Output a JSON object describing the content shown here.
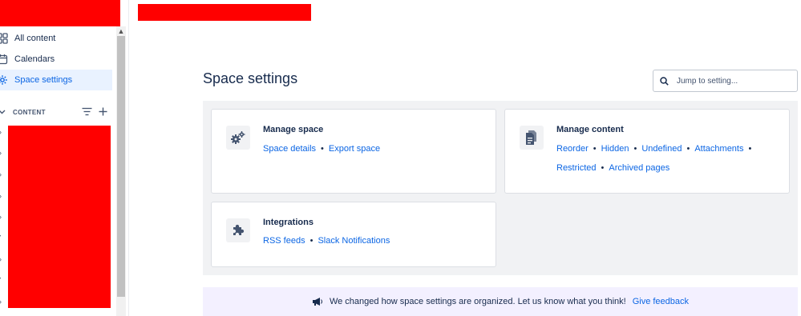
{
  "sidebar": {
    "items": [
      {
        "label": "All content",
        "icon": "grid-icon"
      },
      {
        "label": "Calendars",
        "icon": "calendar-icon"
      },
      {
        "label": "Space settings",
        "icon": "gear-icon",
        "active": true
      }
    ],
    "section_label": "CONTENT"
  },
  "main": {
    "title": "Space settings",
    "search": {
      "placeholder": "Jump to setting..."
    },
    "cards": {
      "manage_space": {
        "title": "Manage space",
        "links": [
          "Space details",
          "Export space"
        ]
      },
      "manage_content": {
        "title": "Manage content",
        "links": [
          "Reorder",
          "Hidden",
          "Undefined",
          "Attachments",
          "Restricted",
          "Archived pages"
        ]
      },
      "integrations": {
        "title": "Integrations",
        "links": [
          "RSS feeds",
          "Slack Notifications"
        ]
      }
    },
    "banner": {
      "message": "We changed how space settings are organized. Let us know what you think!",
      "link": "Give feedback"
    }
  },
  "colors": {
    "accent": "#0c66e4",
    "active_bg": "#e9f2ff",
    "panel_bg": "#f1f2f4",
    "banner_bg": "#f3f0ff",
    "redaction": "#ff0000"
  }
}
